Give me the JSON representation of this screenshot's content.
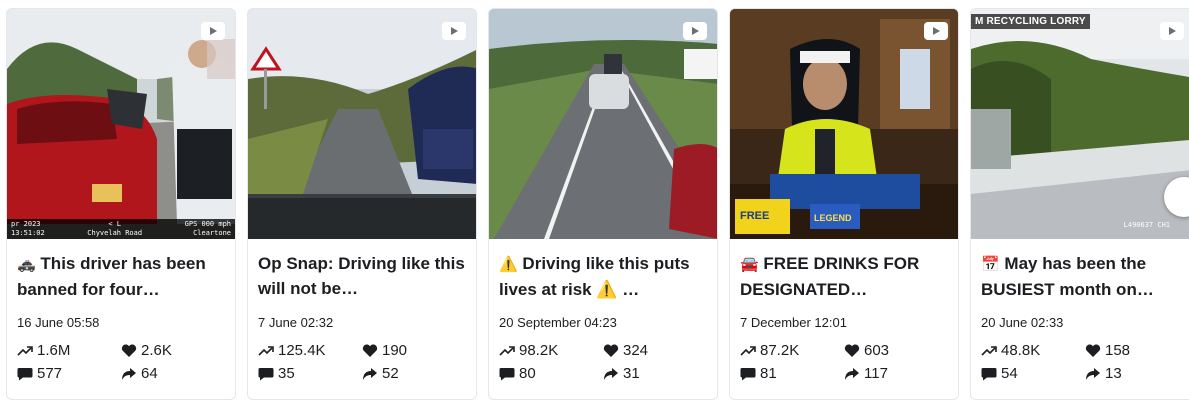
{
  "cards": [
    {
      "emoji": "🚓",
      "title": "This driver has been banned for four…",
      "date": "16 June 05:58",
      "views": "1.6M",
      "likes": "2.6K",
      "comments": "577",
      "shares": "64",
      "overlay": {
        "left1": "pr 2023",
        "left2": "13:51:02",
        "mid1": "< L",
        "mid2": "Chyvelah Road",
        "right1": "GPS 000 mph",
        "right2": "Cleartone"
      }
    },
    {
      "emoji": "",
      "title": "Op Snap: Driving like this will not be…",
      "date": "7 June 02:32",
      "views": "125.4K",
      "likes": "190",
      "comments": "35",
      "shares": "52"
    },
    {
      "emoji": "⚠️",
      "title": "Driving like this puts lives at risk ⚠️ …",
      "date": "20 September 04:23",
      "views": "98.2K",
      "likes": "324",
      "comments": "80",
      "shares": "31"
    },
    {
      "emoji": "🚘",
      "title": "FREE DRINKS FOR DESIGNATED…",
      "date": "7 December 12:01",
      "views": "87.2K",
      "likes": "603",
      "comments": "81",
      "shares": "117",
      "sign_text": "FREE",
      "badge_text": "LEGEND"
    },
    {
      "emoji": "📅",
      "title": "May has been the BUSIEST month on…",
      "date": "20 June 02:33",
      "views": "48.8K",
      "likes": "158",
      "comments": "54",
      "shares": "13",
      "caption_tag": "M RECYCLING LORRY",
      "stamp": "L490637 CH1"
    }
  ],
  "colors": {
    "text": "#1c1e21",
    "border": "#e4e6eb"
  },
  "icons": [
    "video-icon",
    "trending-up-icon",
    "heart-icon",
    "comment-icon",
    "share-icon"
  ]
}
